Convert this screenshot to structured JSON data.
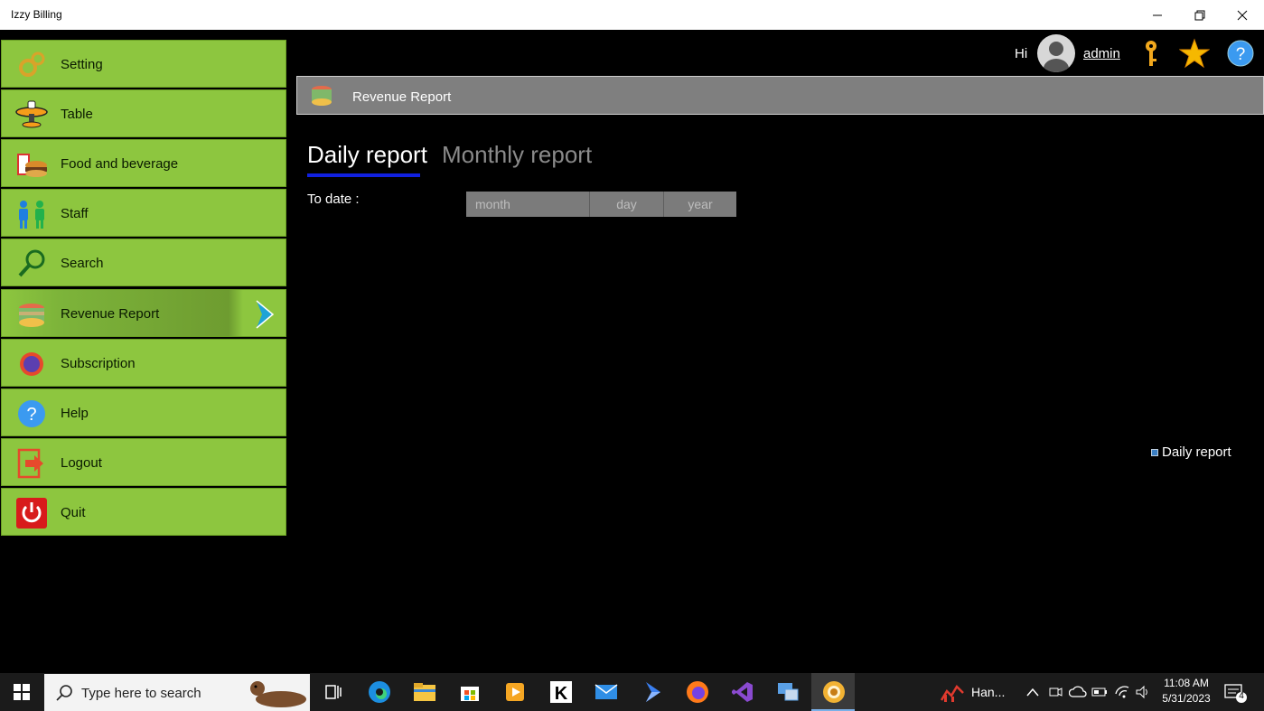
{
  "window": {
    "title": "Izzy Billing",
    "controls": [
      "minimize",
      "restore",
      "close"
    ]
  },
  "sidebar": {
    "items": [
      {
        "label": "Setting",
        "icon": "gears-icon"
      },
      {
        "label": "Table",
        "icon": "table-icon"
      },
      {
        "label": "Food and beverage",
        "icon": "food-icon"
      },
      {
        "label": "Staff",
        "icon": "staff-icon"
      },
      {
        "label": "Search",
        "icon": "search-icon"
      },
      {
        "label": "Revenue Report",
        "icon": "revenue-icon",
        "active": true
      },
      {
        "label": "Subscription",
        "icon": "subscription-icon"
      },
      {
        "label": "Help",
        "icon": "help-icon"
      },
      {
        "label": "Logout",
        "icon": "logout-icon"
      },
      {
        "label": "Quit",
        "icon": "power-icon"
      }
    ]
  },
  "user": {
    "greeting": "Hi",
    "name": "admin"
  },
  "header": {
    "title": "Revenue Report"
  },
  "tabs": [
    {
      "label": "Daily report",
      "selected": true
    },
    {
      "label": "Monthly report",
      "selected": false
    }
  ],
  "filter": {
    "label": "To date :",
    "month_placeholder": "month",
    "day_placeholder": "day",
    "year_placeholder": "year"
  },
  "legend": {
    "label": "Daily report"
  },
  "taskbar": {
    "search_placeholder": "Type here to search",
    "app_label": "Han...",
    "time": "11:08 AM",
    "date": "5/31/2023",
    "notification_count": "4"
  },
  "colors": {
    "sidebar_green": "#8dc63f",
    "header_gray": "#7f7f7f",
    "tab_underline": "#1020e0",
    "background": "#000000"
  }
}
